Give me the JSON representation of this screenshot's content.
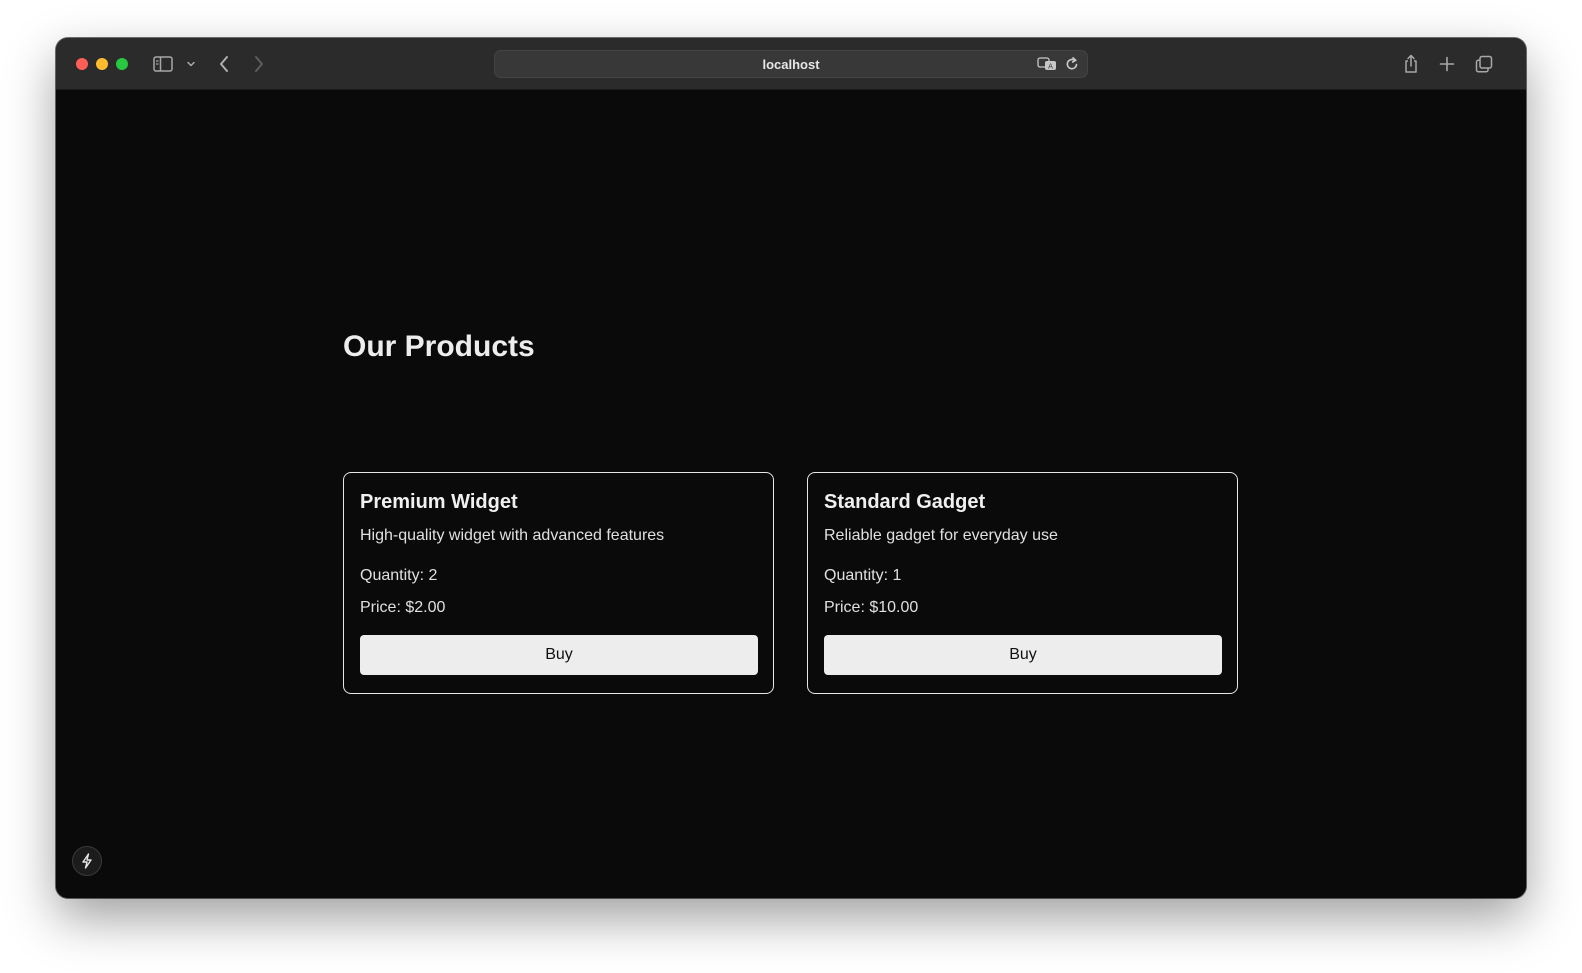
{
  "browser": {
    "url": "localhost"
  },
  "page": {
    "title": "Our Products"
  },
  "products": [
    {
      "name": "Premium Widget",
      "description": "High-quality widget with advanced features",
      "quantity_text": "Quantity: 2",
      "price_text": "Price: $2.00",
      "button_label": "Buy"
    },
    {
      "name": "Standard Gadget",
      "description": "Reliable gadget for everyday use",
      "quantity_text": "Quantity: 1",
      "price_text": "Price: $10.00",
      "button_label": "Buy"
    }
  ],
  "icons": {
    "sidebar": "sidebar-icon",
    "chevron": "chevron-down-icon",
    "back": "back-icon",
    "forward": "forward-icon",
    "translate": "translate-icon",
    "reload": "reload-icon",
    "share": "share-icon",
    "new_tab": "plus-icon",
    "tabs": "tabs-overview-icon",
    "dev": "bolt-icon"
  },
  "colors": {
    "background": "#0a0a0a",
    "card_border": "#e6e6e6",
    "button_bg": "#ededed",
    "text": "#ededed"
  }
}
